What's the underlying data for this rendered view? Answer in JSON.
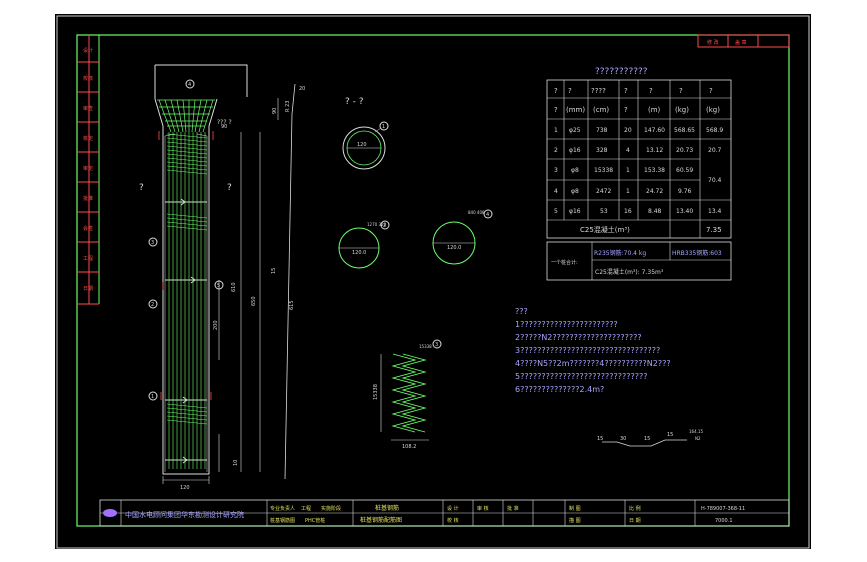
{
  "section_label": "? - ?",
  "table": {
    "title": "???????????",
    "head1": [
      "?",
      "?",
      "????",
      "?",
      "?",
      "?",
      "?"
    ],
    "head2": [
      "?",
      "(mm)",
      "(cm)",
      "?",
      "(m)",
      "(kg)",
      "(kg)"
    ],
    "rows": [
      {
        "no": "1",
        "dia": "φ25",
        "len": "738",
        "n": "20",
        "total": "147.60",
        "w": "568.65",
        "sum": "568.9"
      },
      {
        "no": "2",
        "dia": "φ16",
        "len": "328",
        "n": "4",
        "total": "13.12",
        "w": "20.73",
        "sum": "20.7"
      },
      {
        "no": "3",
        "dia": "φ8",
        "len": "15338",
        "n": "1",
        "total": "153.38",
        "w": "60.59",
        "sum": "70.4"
      },
      {
        "no": "4",
        "dia": "φ8",
        "len": "2472",
        "n": "1",
        "total": "24.72",
        "w": "9.76",
        "sum": ""
      },
      {
        "no": "5",
        "dia": "φ16",
        "len": "53",
        "n": "16",
        "total": "8.48",
        "w": "13.40",
        "sum": "13.4"
      }
    ],
    "concrete_label": "C25混凝土(m³)",
    "concrete_value": "7.35",
    "footer_left": "一个桩合计:",
    "r235": "R235钢筋:70.4 kg",
    "hrb335": "HRB335钢筋:603",
    "footer_concrete": "C25混凝土(m³): 7.35m³"
  },
  "notes": [
    "???",
    "1???????????????????????",
    "2?????N2?????????????????????",
    "3?????????????????????????????????",
    "4????N5??2m???????4??????????N2???",
    "5??????????????????????????????",
    "6??????????????2.4m?"
  ],
  "dims": {
    "width_120": "120",
    "d_120": "120",
    "d_120b": "120.0",
    "d_120c": "120.0",
    "len_610": "610",
    "len_650": "650",
    "len_615": "615",
    "len_200": "200",
    "len_10": "10",
    "len_90": "90",
    "len_15": "15",
    "len_20": "20",
    "spacing": "??? ?",
    "spiral_top": "15338",
    "spiral_left": "15338",
    "spiral_w": "108.2",
    "bent_a": "30",
    "bent_b": "15",
    "bent_c": "15",
    "bent_d": "164.15",
    "bent_e": "N2",
    "bar2_top": "1270\n328",
    "bar4_top": "840\n408",
    "r_top": "R 23"
  },
  "markers": {
    "m1": "1",
    "m2": "2",
    "m3": "3",
    "m4": "4",
    "m5": "5"
  },
  "side_qmark": "?",
  "title_block": {
    "org": "中国水电顾问集团华东勘测设计研究院",
    "row1": [
      "专业负责人",
      "工程",
      "实施阶段"
    ],
    "row2": [
      "桩基钢筋图",
      "PHC管桩"
    ],
    "c_title1": "桩基钢筋",
    "c_title2": "桩基钢筋配筋图",
    "mid": [
      "设 计",
      "校 核",
      "审 核",
      "批 准"
    ],
    "right1": "制 图",
    "right2": "描 图",
    "scale": "比 例",
    "date": "日 期",
    "drawing_no": "H-789007-368-11",
    "sheet": "7000.1"
  },
  "revision_cells": [
    "修 改",
    "盖 章"
  ],
  "left_strip": [
    "设计",
    "校核",
    "审查",
    "核定",
    "审定",
    "批准",
    "会签",
    "工程",
    "日期"
  ]
}
